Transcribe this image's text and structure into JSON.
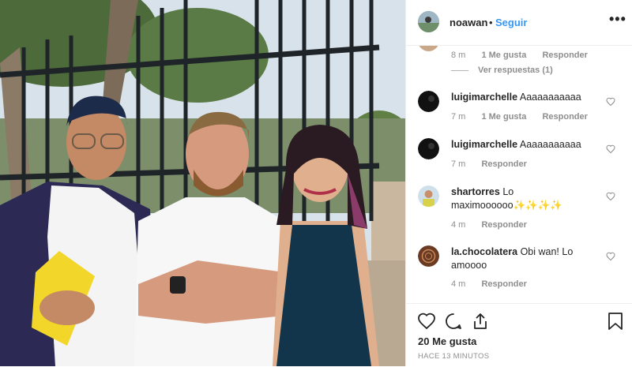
{
  "post": {
    "username": "noawan",
    "separator": "•",
    "follow_label": "Seguir",
    "more_label": "•••"
  },
  "comments": {
    "first_meta": {
      "time": "8 m",
      "likes": "1 Me gusta",
      "reply": "Responder"
    },
    "view_replies": "Ver respuestas (1)",
    "items": [
      {
        "user": "luigimarchelle",
        "text": "Aaaaaaaaaaa",
        "time": "7 m",
        "likes": "1 Me gusta",
        "reply": "Responder"
      },
      {
        "user": "luigimarchelle",
        "text": "Aaaaaaaaaaa",
        "time": "7 m",
        "reply": "Responder"
      },
      {
        "user": "shartorres",
        "text": "Lo maximoooooo✨✨✨✨",
        "time": "4 m",
        "reply": "Responder"
      },
      {
        "user": "la.chocolatera",
        "text": "Obi wan! Lo amoooo",
        "time": "4 m",
        "reply": "Responder"
      }
    ]
  },
  "footer": {
    "likes": "20 Me gusta",
    "time_ago": "HACE 13 MINUTOS"
  },
  "icons": {
    "like": "heart-icon",
    "comment": "comment-icon",
    "share": "share-icon",
    "save": "bookmark-icon"
  },
  "colors": {
    "accent": "#3897f0",
    "text": "#262626",
    "muted": "#8e8e8e"
  }
}
